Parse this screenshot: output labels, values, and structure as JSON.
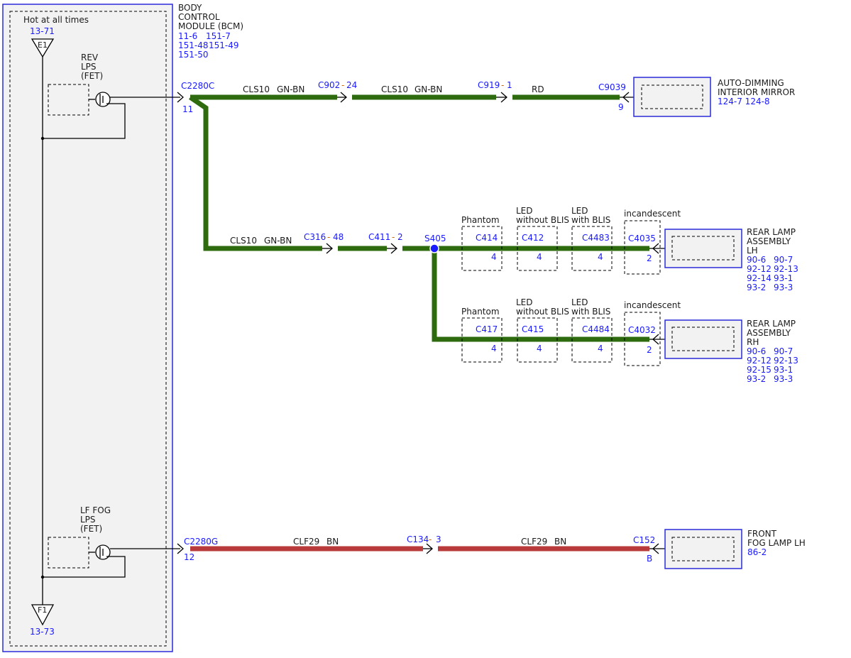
{
  "bcm": {
    "title_lines": [
      "BODY",
      "CONTROL",
      "MODULE (BCM)"
    ],
    "refs": [
      "11-6",
      "151-7",
      "151-48",
      "151-49",
      "151-50"
    ],
    "hot_label": "Hot at all times",
    "e1_ref": "13-71",
    "e1_label": "E1",
    "f1_label": "F1",
    "f1_ref": "13-73",
    "rev_lines": [
      "REV",
      "LPS",
      "(FET)"
    ],
    "lf_lines": [
      "LF FOG",
      "LPS",
      "(FET)"
    ]
  },
  "circuit_rev": {
    "bcm_connector": "C2280C",
    "bcm_pin": "11",
    "seg1_circuit": "CLS10",
    "seg1_color": "GN-BN",
    "c902": "C902",
    "c902_pin": "24",
    "seg2_circuit": "CLS10",
    "seg2_color": "GN-BN",
    "c919": "C919",
    "c919_pin": "1",
    "seg3_color": "RD",
    "c9039": "C9039",
    "c9039_pin": "9",
    "mirror_lines": [
      "AUTO-DIMMING",
      "INTERIOR MIRROR"
    ],
    "mirror_refs": "124-7 124-8",
    "mid_circuit": "CLS10",
    "mid_color": "GN-BN",
    "c316": "C316",
    "c316_pin": "48",
    "c411": "C411",
    "c411_pin": "2",
    "splice": "S405"
  },
  "lh_branch": {
    "options": [
      {
        "desc": [
          "Phantom"
        ],
        "connector": "C414",
        "pin": "4"
      },
      {
        "desc": [
          "LED",
          "without BLIS"
        ],
        "connector": "C412",
        "pin": "4"
      },
      {
        "desc": [
          "LED",
          "with BLIS"
        ],
        "connector": "C4483",
        "pin": "4"
      },
      {
        "desc": [
          "incandescent"
        ],
        "connector": "C4035",
        "pin": "2"
      }
    ],
    "module_lines": [
      "REAR LAMP",
      "ASSEMBLY",
      "LH"
    ],
    "refs": [
      "90-6",
      "90-7",
      "92-12",
      "92-13",
      "92-14",
      "93-1",
      "93-2",
      "93-3"
    ]
  },
  "rh_branch": {
    "options": [
      {
        "desc": [
          "Phantom"
        ],
        "connector": "C417",
        "pin": "4"
      },
      {
        "desc": [
          "LED",
          "without BLIS"
        ],
        "connector": "C415",
        "pin": "4"
      },
      {
        "desc": [
          "LED",
          "with BLIS"
        ],
        "connector": "C4484",
        "pin": "4"
      },
      {
        "desc": [
          "incandescent"
        ],
        "connector": "C4032",
        "pin": "2"
      }
    ],
    "module_lines": [
      "REAR LAMP",
      "ASSEMBLY",
      "RH"
    ],
    "refs": [
      "90-6",
      "90-7",
      "92-12",
      "92-13",
      "92-15",
      "93-1",
      "93-2",
      "93-3"
    ]
  },
  "circuit_fog": {
    "bcm_connector": "C2280G",
    "bcm_pin": "12",
    "seg1_circuit": "CLF29",
    "seg1_color": "BN",
    "c134": "C134",
    "c134_pin": "3",
    "seg2_circuit": "CLF29",
    "seg2_color": "BN",
    "c152": "C152",
    "c152_pin": "B",
    "module_lines": [
      "FRONT",
      "FOG LAMP LH"
    ],
    "module_ref": "86-2"
  },
  "colors": {
    "wire_green": "#2e6b0e",
    "wire_red": "#b83a3a",
    "ref_blue": "#1a1aff",
    "dash_orange": "#cc6600"
  }
}
